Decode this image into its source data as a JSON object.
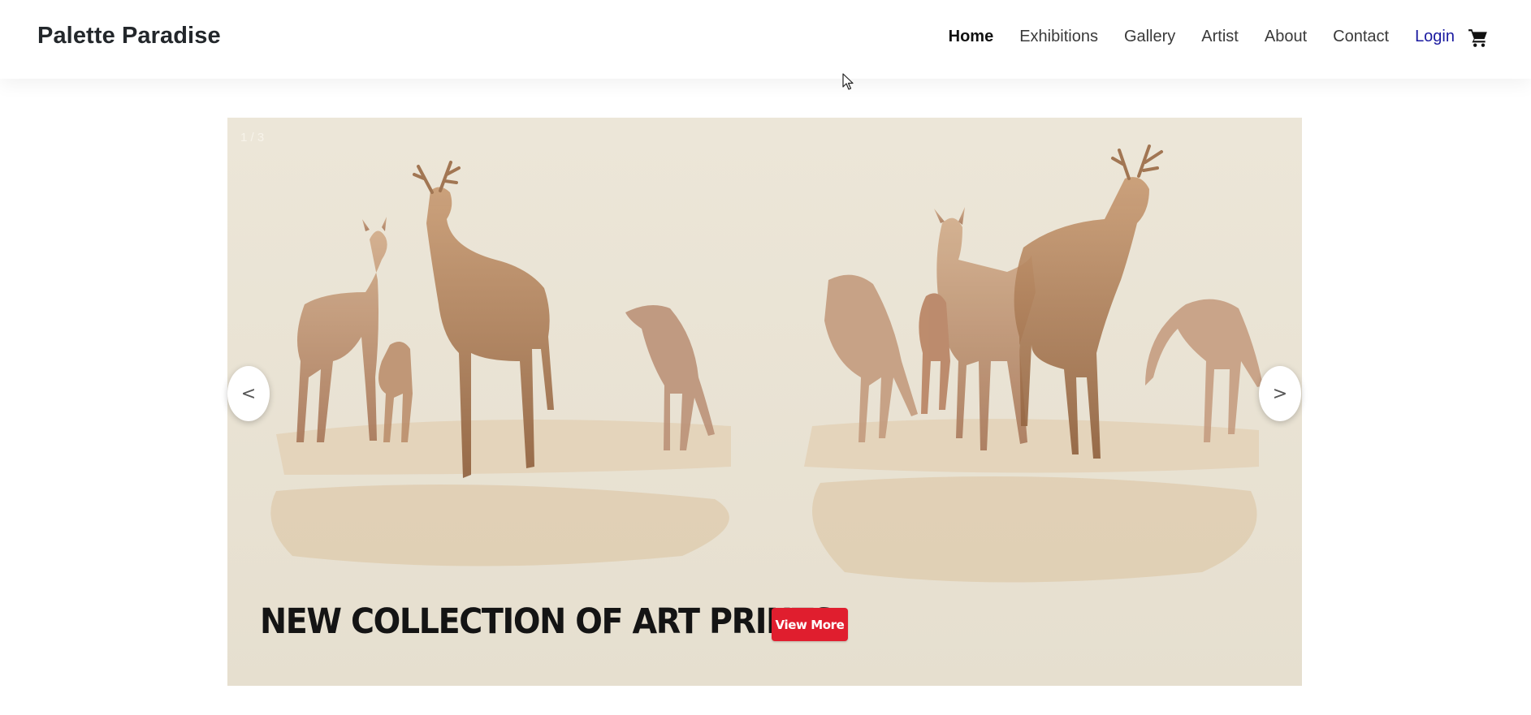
{
  "header": {
    "brand": "Palette Paradise",
    "nav": {
      "home": "Home",
      "exhibitions": "Exhibitions",
      "gallery": "Gallery",
      "artist": "Artist",
      "about": "About",
      "contact": "Contact",
      "login": "Login"
    },
    "cart_icon": "shopping-cart-icon"
  },
  "carousel": {
    "counter": "1 / 3",
    "prev_label": "<",
    "next_label": ">",
    "slide": {
      "headline": "NEW COLLECTION OF ART PRINTS",
      "button_label": "View More",
      "image_subject": "watercolor deer herd"
    }
  },
  "colors": {
    "accent_button": "#e01e2e",
    "login_link": "#1a1aa0",
    "slide_background": "#ebe4d6"
  }
}
